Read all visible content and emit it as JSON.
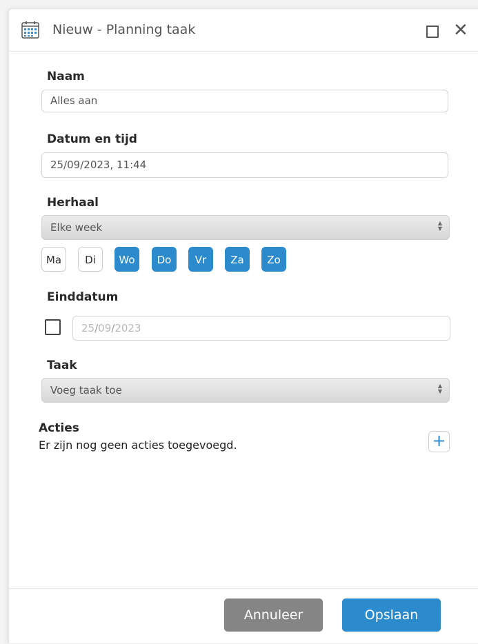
{
  "window": {
    "title": "Nieuw - Planning taak",
    "icon": "calendar-icon"
  },
  "form": {
    "name": {
      "label": "Naam",
      "value": "Alles aan"
    },
    "datetime": {
      "label": "Datum en tijd",
      "value": "25/09/2023, 11:44"
    },
    "repeat": {
      "label": "Herhaal",
      "selected": "Elke week",
      "days": [
        {
          "label": "Ma",
          "selected": false
        },
        {
          "label": "Di",
          "selected": false
        },
        {
          "label": "Wo",
          "selected": true
        },
        {
          "label": "Do",
          "selected": true
        },
        {
          "label": "Vr",
          "selected": true
        },
        {
          "label": "Za",
          "selected": true
        },
        {
          "label": "Zo",
          "selected": true
        }
      ]
    },
    "end_date": {
      "label": "Einddatum",
      "checked": false,
      "day": "25",
      "month": "09",
      "year": "2023",
      "separator": "/"
    },
    "task": {
      "label": "Taak",
      "selected": "Voeg taak toe"
    },
    "actions": {
      "label": "Acties",
      "empty_text": "Er zijn nog geen acties toegevoegd.",
      "add_symbol": "+"
    }
  },
  "footer": {
    "cancel_label": "Annuleer",
    "save_label": "Opslaan"
  },
  "colors": {
    "accent": "#2b8bcd",
    "cancel": "#858585"
  }
}
